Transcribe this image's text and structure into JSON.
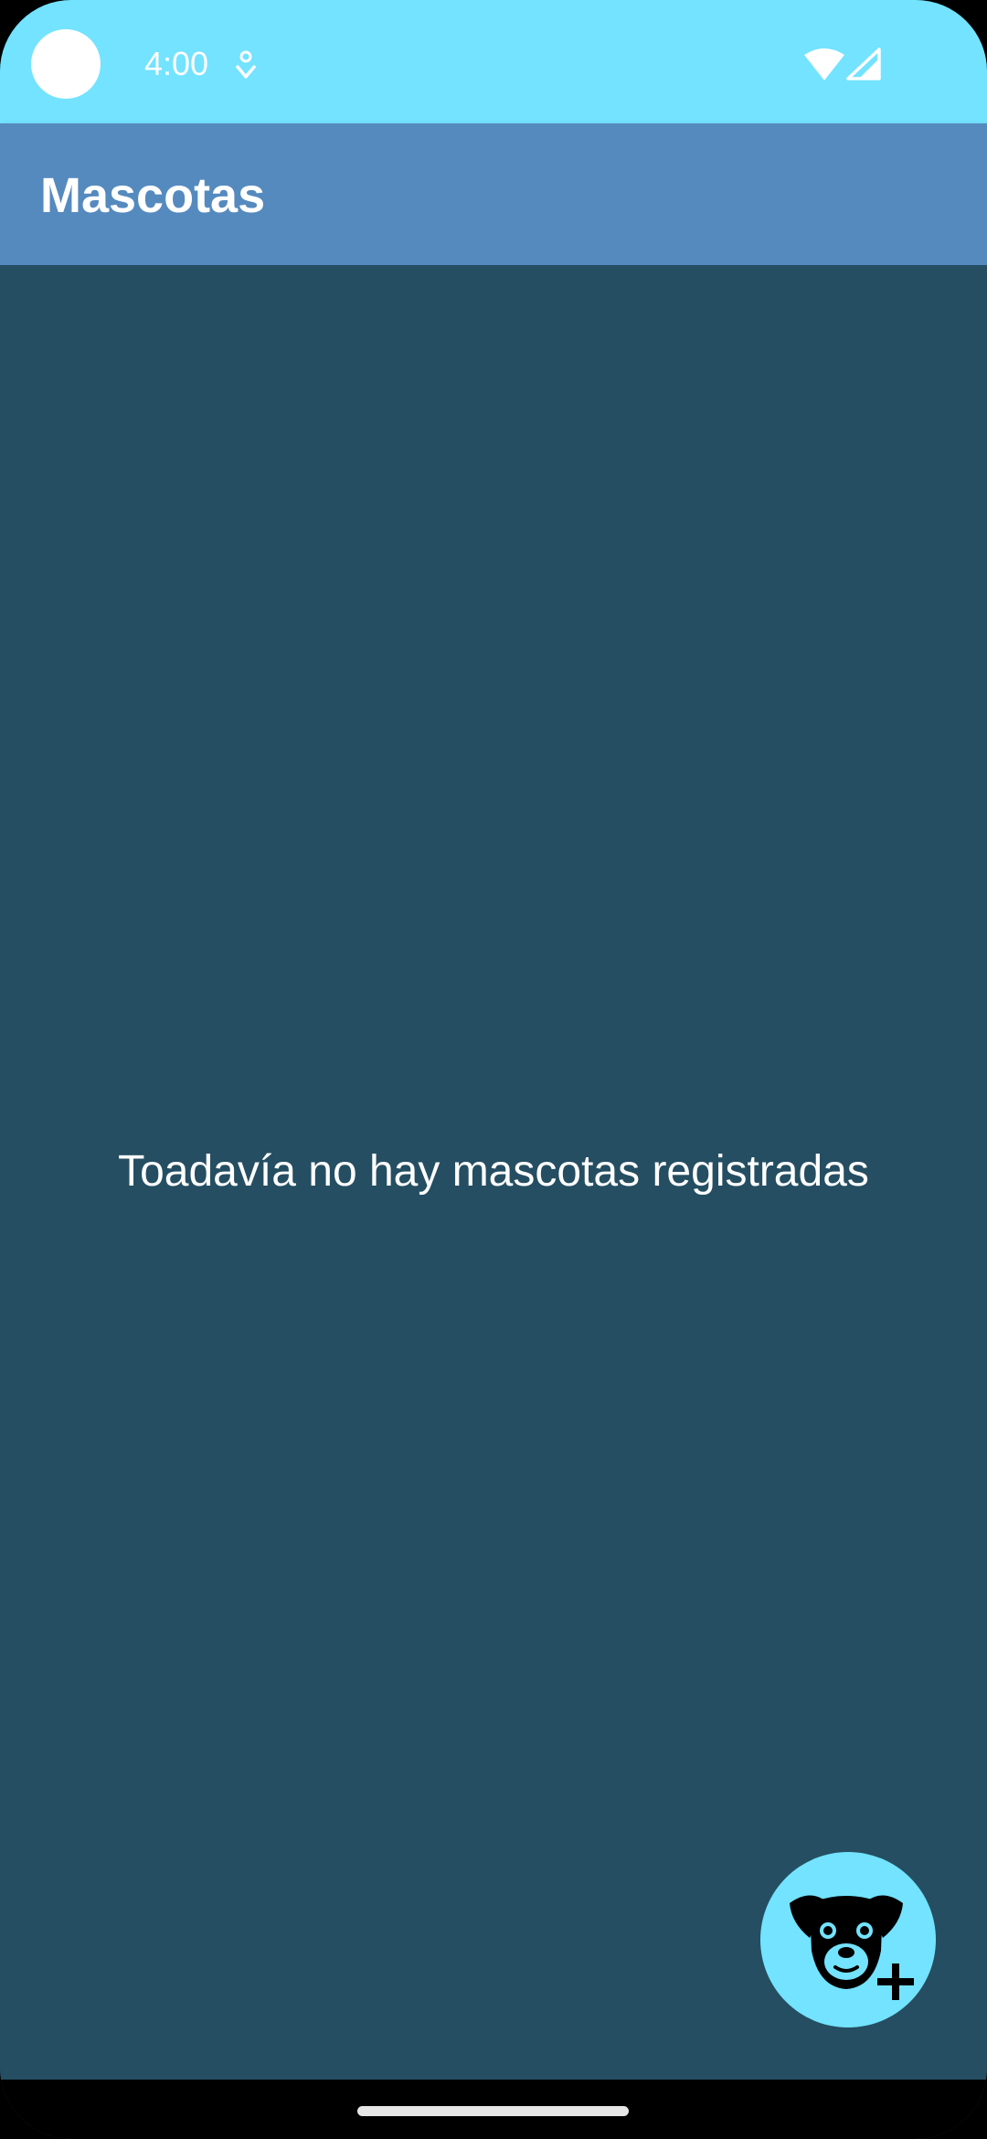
{
  "status_bar": {
    "time": "4:00",
    "background_color": "#73e3ff",
    "icons": [
      "notification-icon",
      "wifi-icon",
      "signal-icon"
    ]
  },
  "app_bar": {
    "title": "Mascotas",
    "background_color": "#558abf"
  },
  "main": {
    "empty_message": "Toadavía no hay mascotas registradas",
    "background_color": "#254e62"
  },
  "fab": {
    "icon": "add-pet-icon",
    "background_color": "#73e3ff"
  },
  "nav_bar": {
    "home_indicator": "home-indicator"
  }
}
